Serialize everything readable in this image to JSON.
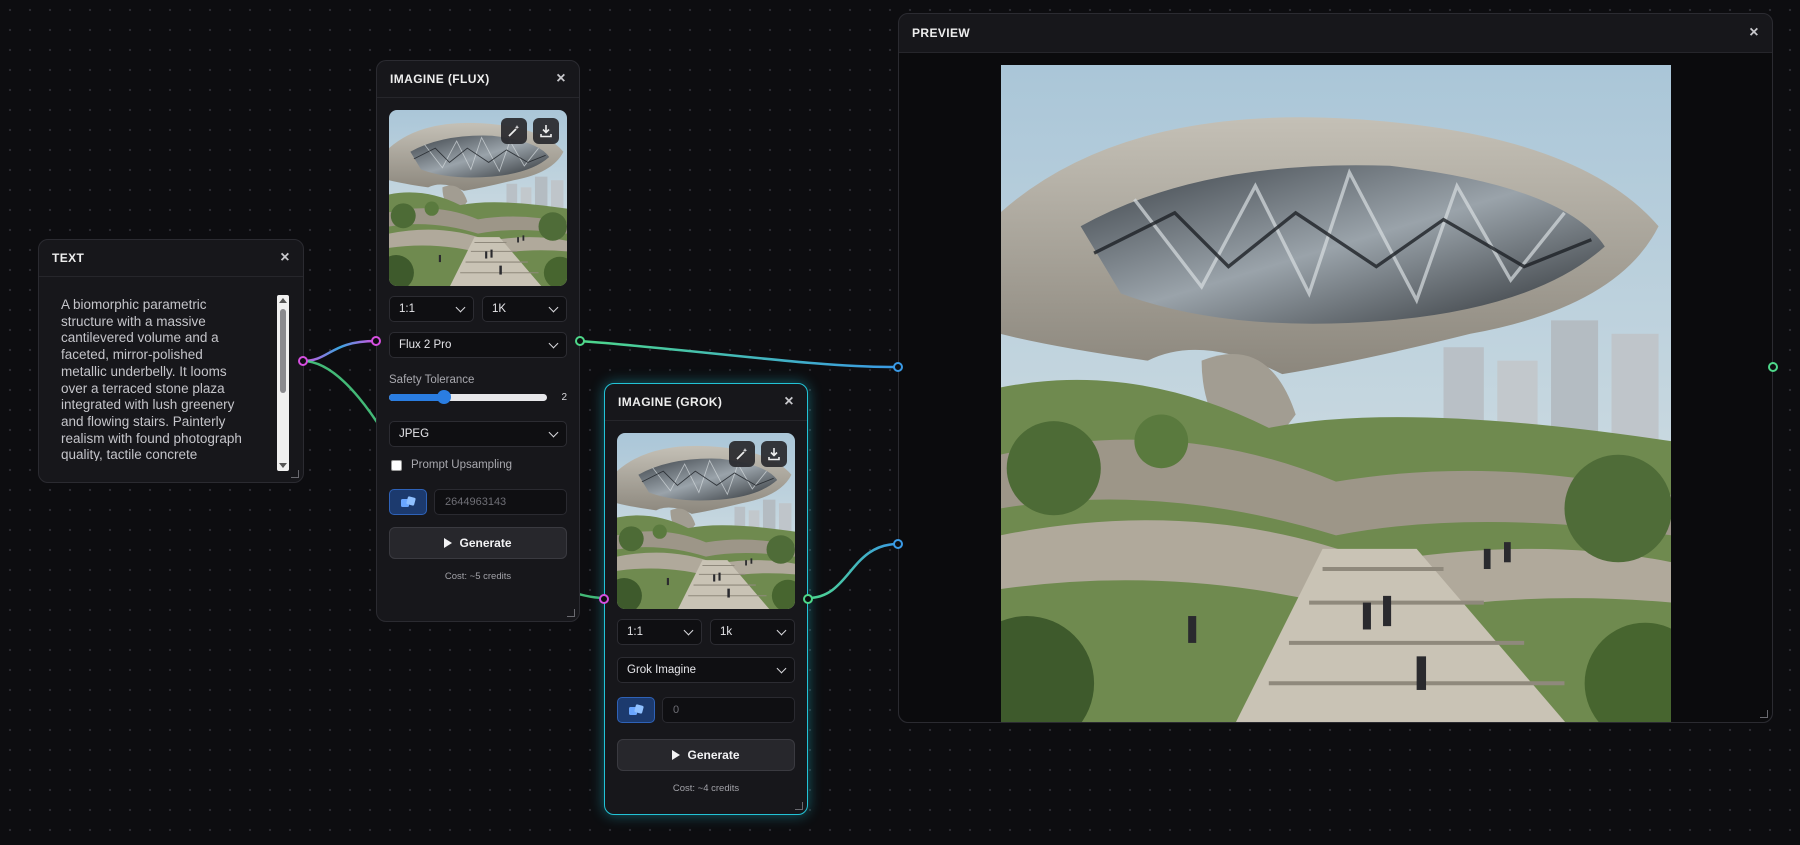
{
  "text_node": {
    "title": "TEXT",
    "close": "×",
    "content": "A biomorphic parametric structure with a massive cantilevered volume and a faceted, mirror-polished metallic underbelly. It looms over a terraced stone plaza integrated with lush greenery and flowing stairs. Painterly realism with found photograph quality, tactile concrete"
  },
  "flux_node": {
    "title": "IMAGINE (FLUX)",
    "close": "×",
    "aspect_ratio": "1:1",
    "resolution": "1K",
    "model": "Flux 2 Pro",
    "safety_label": "Safety Tolerance",
    "safety_value": "2",
    "safety_fraction": 0.35,
    "format": "JPEG",
    "upsampling_label": "Prompt Upsampling",
    "upsampling_checked": false,
    "seed_placeholder": "2644963143",
    "generate_label": "Generate",
    "cost": "Cost: ~5 credits"
  },
  "grok_node": {
    "title": "IMAGINE (GROK)",
    "close": "×",
    "aspect_ratio": "1:1",
    "resolution": "1k",
    "model": "Grok Imagine",
    "seed_placeholder": "0",
    "generate_label": "Generate",
    "cost": "Cost: ~4 credits"
  },
  "preview_node": {
    "title": "PREVIEW",
    "close": "×",
    "split_handle": "‹›"
  },
  "colors": {
    "background": "#0d0d10",
    "node": "#17171b",
    "accent_blue": "#2a7de1",
    "grok_glow": "#22c3d6",
    "wire_magenta": "#d64fe0",
    "wire_green": "#4ed88a",
    "wire_blue": "#3a9ae6"
  },
  "icons": {
    "thumbnail_edit": "magic-wand-icon",
    "thumbnail_download": "download-icon",
    "seed_randomize": "dice-icon",
    "generate": "play-icon"
  }
}
